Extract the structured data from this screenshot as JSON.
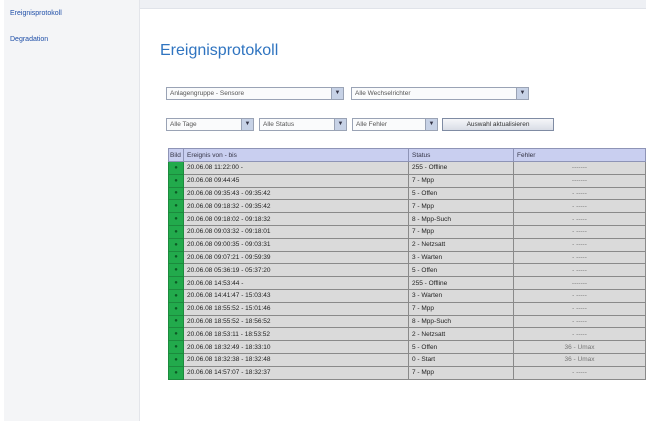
{
  "sidebar": {
    "items": [
      {
        "label": "Ereignisprotokoll"
      },
      {
        "label": "Degradation"
      }
    ]
  },
  "page": {
    "title": "Ereignisprotokoll"
  },
  "filters": {
    "gruppe": "Anlagengruppe - Sensore",
    "speicher": "Alle Wechselrichter",
    "tage": "Alle Tage",
    "status": "Alle Status",
    "fehler": "Alle Fehler",
    "button": "Auswahl aktualisieren"
  },
  "table": {
    "headers": [
      "Bild",
      "Ereignis von - bis",
      "Status",
      "Fehler"
    ],
    "rows": [
      {
        "zeit": "20.06.08 11:22:00 -",
        "status": "255 - Offline",
        "fehler": "-------"
      },
      {
        "zeit": "20.06.08 09:44:45",
        "status": "7 - Mpp",
        "fehler": "-------"
      },
      {
        "zeit": "20.06.08 09:35:43 - 09:35:42",
        "status": "5 - Offen",
        "fehler": "- -----"
      },
      {
        "zeit": "20.06.08 09:18:32 - 09:35:42",
        "status": "7 - Mpp",
        "fehler": "- -----"
      },
      {
        "zeit": "20.06.08 09:18:02 - 09:18:32",
        "status": "8 - Mpp-Such",
        "fehler": "- -----"
      },
      {
        "zeit": "20.06.08 09:03:32 - 09:18:01",
        "status": "7 - Mpp",
        "fehler": "- -----"
      },
      {
        "zeit": "20.06.08 09:00:35 - 09:03:31",
        "status": "2 - Netzsatt",
        "fehler": "- -----"
      },
      {
        "zeit": "20.06.08 09:07:21 - 09:59:39",
        "status": "3 - Warten",
        "fehler": "- -----"
      },
      {
        "zeit": "20.06.08 05:36:19 - 05:37:20",
        "status": "5 - Offen",
        "fehler": "- -----"
      },
      {
        "zeit": "20.06.08 14:53:44 -",
        "status": "255 - Offline",
        "fehler": "-------"
      },
      {
        "zeit": "20.06.08 14:41:47 - 15:03:43",
        "status": "3 - Warten",
        "fehler": "- -----"
      },
      {
        "zeit": "20.06.08 18:55:52 - 15:01:46",
        "status": "7 - Mpp",
        "fehler": "- -----"
      },
      {
        "zeit": "20.06.08 18:55:52 - 18:56:52",
        "status": "8 - Mpp-Such",
        "fehler": "- -----"
      },
      {
        "zeit": "20.06.08 18:53:11 - 18:53:52",
        "status": "2 - Netzsatt",
        "fehler": "- -----"
      },
      {
        "zeit": "20.06.08 18:32:49 - 18:33:10",
        "status": "5 - Offen",
        "fehler": "36 - Umax"
      },
      {
        "zeit": "20.06.08 18:32:38 - 18:32:48",
        "status": "0 - Start",
        "fehler": "36 - Umax"
      },
      {
        "zeit": "20.06.08 14:57:07 - 18:32:37",
        "status": "7 - Mpp",
        "fehler": "- -----"
      }
    ]
  }
}
